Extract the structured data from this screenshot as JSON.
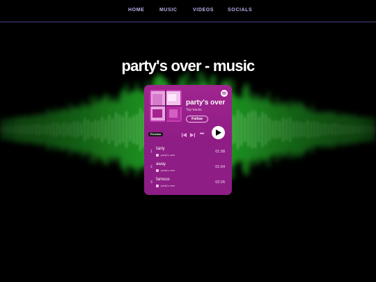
{
  "nav": {
    "items": [
      "HOME",
      "MUSIC",
      "VIDEOS",
      "SOCIALS"
    ]
  },
  "page": {
    "title": "party's over - music"
  },
  "player": {
    "album_title": "party's over",
    "subtitle": "Top tracks",
    "follow_label": "Follow",
    "preview_label": "Preview",
    "more_label": "•••",
    "tracks": [
      {
        "num": "1",
        "name": "fairly",
        "artist": "party's over",
        "time": "01:38"
      },
      {
        "num": "2",
        "name": "away",
        "artist": "party's over",
        "time": "01:54"
      },
      {
        "num": "3",
        "name": "famous",
        "artist": "party's over",
        "time": "02:26"
      }
    ]
  },
  "colors": {
    "background": "#000000",
    "nav_text": "#b9b2ea",
    "nav_border": "#4b3f86",
    "player_bg": "#8e1d85",
    "waveform": "#2bd12e"
  }
}
